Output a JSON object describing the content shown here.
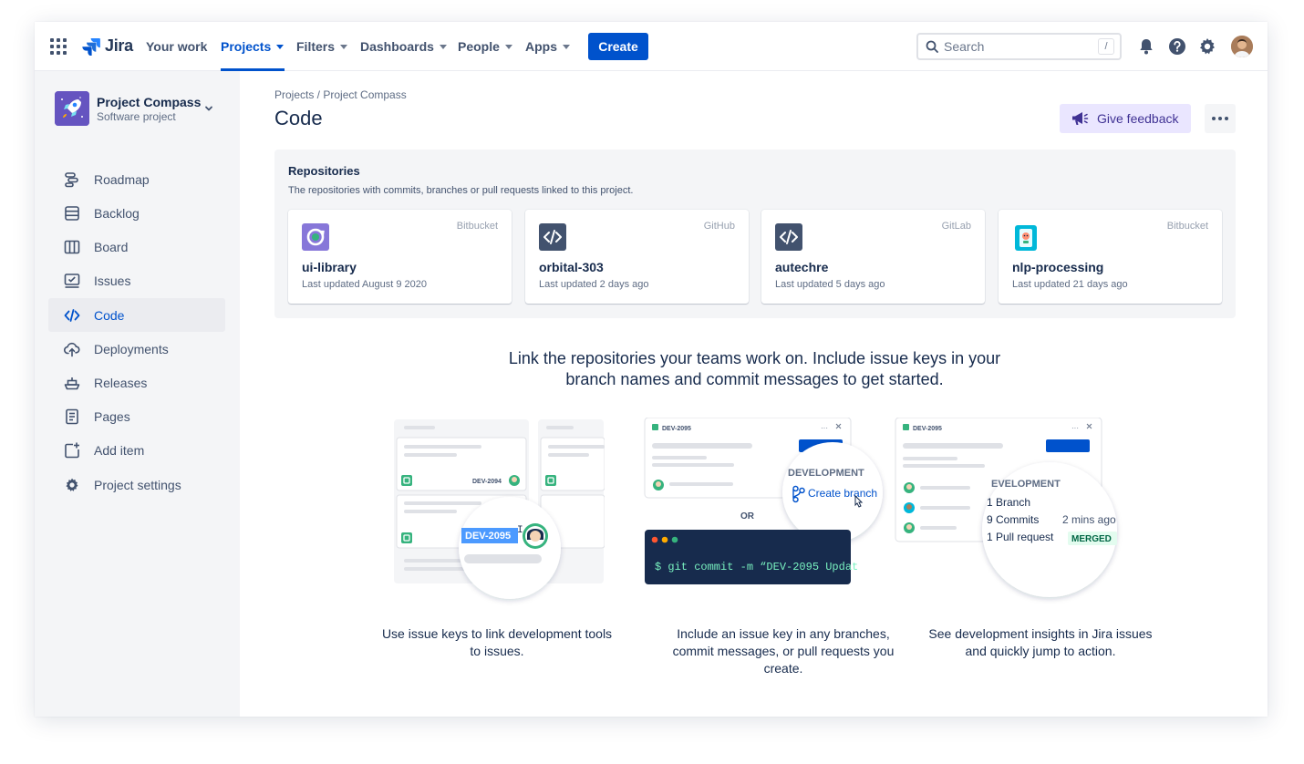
{
  "topnav": {
    "logo": "Jira",
    "items": [
      {
        "label": "Your work",
        "dropdown": false
      },
      {
        "label": "Projects",
        "dropdown": true,
        "active": true
      },
      {
        "label": "Filters",
        "dropdown": true
      },
      {
        "label": "Dashboards",
        "dropdown": true
      },
      {
        "label": "People",
        "dropdown": true
      },
      {
        "label": "Apps",
        "dropdown": true
      }
    ],
    "create_label": "Create",
    "search_placeholder": "Search",
    "search_shortcut": "/"
  },
  "sidebar": {
    "project_name": "Project Compass",
    "project_type": "Software project",
    "items": [
      {
        "label": "Roadmap",
        "icon": "roadmap-icon"
      },
      {
        "label": "Backlog",
        "icon": "backlog-icon"
      },
      {
        "label": "Board",
        "icon": "board-icon"
      },
      {
        "label": "Issues",
        "icon": "issues-icon"
      },
      {
        "label": "Code",
        "icon": "code-icon",
        "active": true
      },
      {
        "label": "Deployments",
        "icon": "deployments-icon"
      },
      {
        "label": "Releases",
        "icon": "releases-icon"
      },
      {
        "label": "Pages",
        "icon": "pages-icon"
      },
      {
        "label": "Add item",
        "icon": "add-item-icon"
      },
      {
        "label": "Project settings",
        "icon": "gear-icon"
      }
    ]
  },
  "main": {
    "breadcrumb": "Projects / Project Compass",
    "title": "Code",
    "feedback_label": "Give feedback",
    "repositories": {
      "title": "Repositories",
      "subtitle": "The repositories with commits, branches or pull requests linked to this project.",
      "cards": [
        {
          "name": "ui-library",
          "provider": "Bitbucket",
          "updated": "Last updated August 9 2020",
          "icon": "sync-icon"
        },
        {
          "name": "orbital-303",
          "provider": "GitHub",
          "updated": "Last updated 2 days ago",
          "icon": "code-icon"
        },
        {
          "name": "autechre",
          "provider": "GitLab",
          "updated": "Last updated 5 days ago",
          "icon": "code-icon"
        },
        {
          "name": "nlp-processing",
          "provider": "Bitbucket",
          "updated": "Last updated 21 days ago",
          "icon": "phone-icon"
        }
      ]
    },
    "headline": "Link the repositories your teams work on. Include issue keys in your branch names and commit messages to get started.",
    "illustrations": {
      "one": {
        "issue_key_small": "DEV-2094",
        "issue_key_highlight": "DEV-2095",
        "caption": "Use issue keys to link development tools to issues."
      },
      "two": {
        "card_key": "DEV-2095",
        "dev_heading": "DEVELOPMENT",
        "create_branch": "Create branch",
        "or": "OR",
        "terminal": "$ git commit -m “DEV-2095 Updat",
        "caption": "Include an issue key in any branches, commit messages, or pull requests you create."
      },
      "three": {
        "card_key": "DEV-2095",
        "dev_heading": "EVELOPMENT",
        "branch": "1 Branch",
        "commits": "9 Commits",
        "commits_time": "2 mins ago",
        "pull_request": "1 Pull request",
        "merged": "MERGED",
        "caption": "See development insights in Jira issues and quickly jump to action."
      }
    }
  },
  "colors": {
    "brand": "#0052cc",
    "text": "#172b4d",
    "subtle": "#5e6c84",
    "sidebar_bg": "#f4f5f7",
    "merged": "#006644"
  }
}
